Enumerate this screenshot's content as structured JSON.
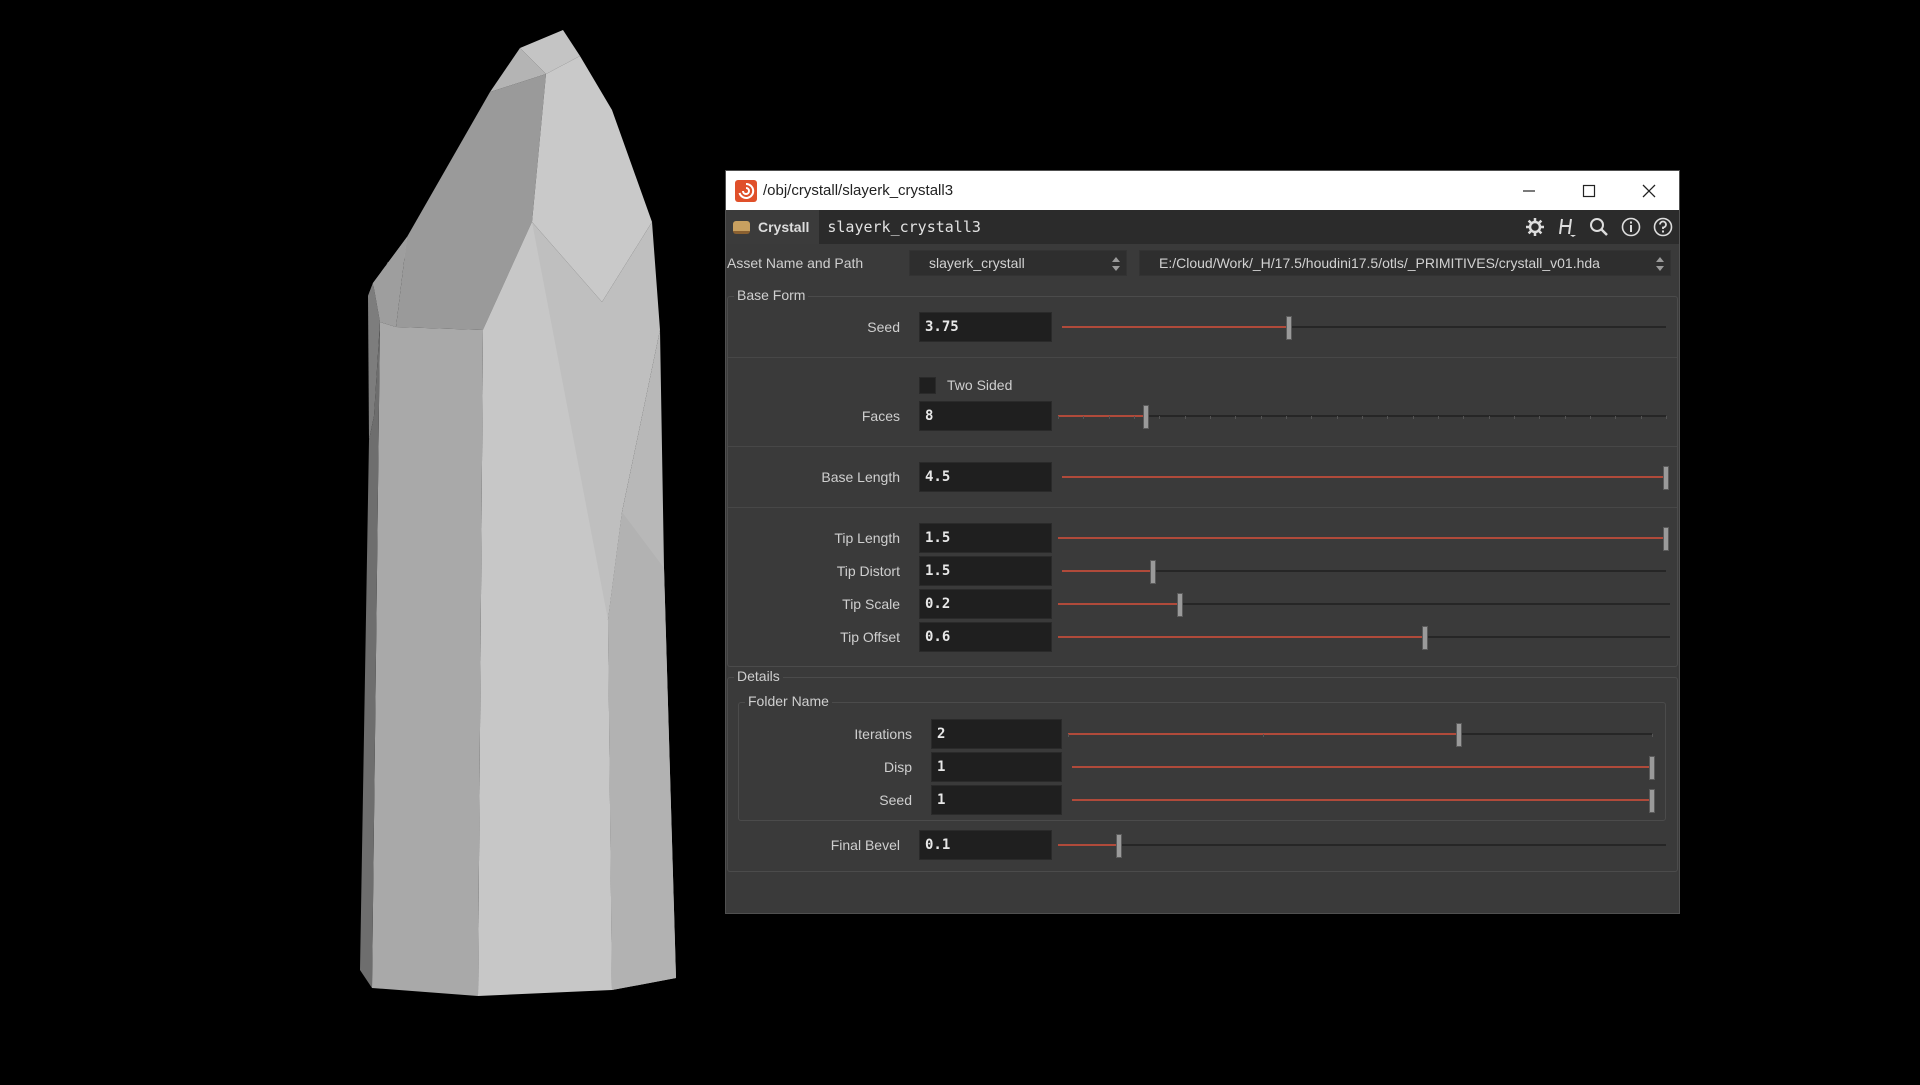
{
  "window": {
    "title": "/obj/crystall/slayerk_crystall3",
    "controls": [
      "minimize-icon",
      "maximize-icon",
      "close-icon"
    ]
  },
  "header": {
    "node_type": "Crystall",
    "node_name": "slayerk_crystall3",
    "icons": [
      "gear-icon",
      "houdini-h-icon",
      "search-icon",
      "info-icon",
      "help-icon"
    ]
  },
  "asset": {
    "label": "Asset Name and Path",
    "name": "slayerk_crystall",
    "path": "E:/Cloud/Work/_H/17.5/houdini17.5/otls/_PRIMITIVES/crystall_v01.hda"
  },
  "base_form": {
    "label": "Base Form",
    "seed": {
      "label": "Seed",
      "value": "3.75",
      "fraction": 0.375
    },
    "two_sided": {
      "label": "Two Sided",
      "checked": false
    },
    "faces": {
      "label": "Faces",
      "value": "8",
      "fraction": 0.145
    },
    "base_length": {
      "label": "Base Length",
      "value": "4.5",
      "fraction": 1.0
    },
    "tip_length": {
      "label": "Tip Length",
      "value": "1.5",
      "fraction": 1.0
    },
    "tip_distort": {
      "label": "Tip Distort",
      "value": "1.5",
      "fraction": 0.15
    },
    "tip_scale": {
      "label": "Tip Scale",
      "value": "0.2",
      "fraction": 0.2
    },
    "tip_offset": {
      "label": "Tip Offset",
      "value": "0.6",
      "fraction": 0.6
    }
  },
  "details": {
    "label": "Details",
    "folder_label": "Folder Name",
    "iterations": {
      "label": "Iterations",
      "value": "2",
      "fraction": 0.67
    },
    "disp": {
      "label": "Disp",
      "value": "1",
      "fraction": 1.0
    },
    "seed": {
      "label": "Seed",
      "value": "1",
      "fraction": 1.0
    },
    "final_bevel": {
      "label": "Final Bevel",
      "value": "0.1",
      "fraction": 0.1
    }
  },
  "colors": {
    "slider_fill": "#b04a3a",
    "panel_bg": "#3a3a3a",
    "field_bg": "#1f1f1f",
    "houdini_orange": "#e0502a"
  }
}
